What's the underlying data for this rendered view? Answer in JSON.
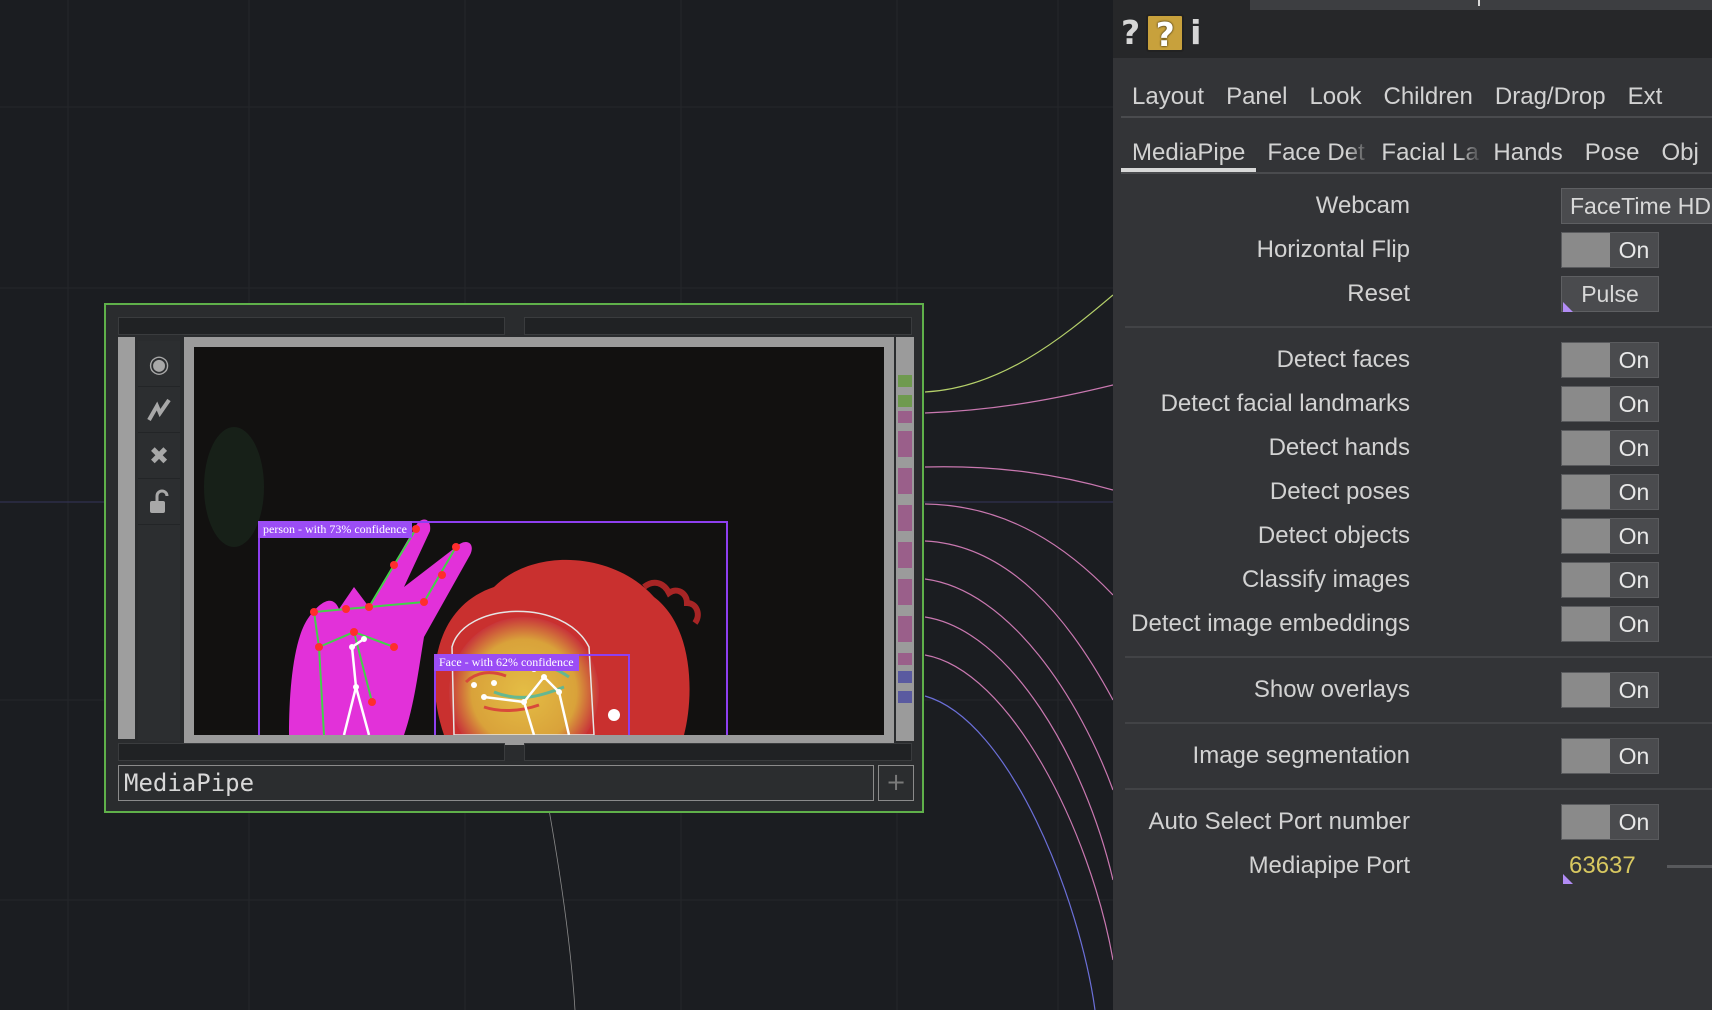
{
  "node": {
    "name": "MediaPipe",
    "tools": [
      "viewer-icon",
      "graph-icon",
      "bypass-icon",
      "lock-icon"
    ],
    "overlays": {
      "person_label": "person - with 73% confidence",
      "face_label": "Face - with 62% confidence"
    },
    "add_symbol": "+"
  },
  "panel": {
    "help_icons": [
      "?",
      "?",
      "i"
    ],
    "tabs_row1": [
      "Layout",
      "Panel",
      "Look",
      "Children",
      "Drag/Drop",
      "Ext"
    ],
    "tabs_row2": [
      "MediaPipe",
      "Face Det",
      "Facial La",
      "Hands",
      "Pose",
      "Obj"
    ],
    "active_tab": "MediaPipe",
    "params": {
      "webcam": {
        "label": "Webcam",
        "value": "FaceTime HD"
      },
      "hflip": {
        "label": "Horizontal Flip",
        "value": "On"
      },
      "reset": {
        "label": "Reset",
        "value": "Pulse"
      },
      "detect_faces": {
        "label": "Detect faces",
        "value": "On"
      },
      "detect_facial_landmarks": {
        "label": "Detect facial landmarks",
        "value": "On"
      },
      "detect_hands": {
        "label": "Detect hands",
        "value": "On"
      },
      "detect_poses": {
        "label": "Detect poses",
        "value": "On"
      },
      "detect_objects": {
        "label": "Detect objects",
        "value": "On"
      },
      "classify_images": {
        "label": "Classify images",
        "value": "On"
      },
      "detect_image_embeddings": {
        "label": "Detect image embeddings",
        "value": "On"
      },
      "show_overlays": {
        "label": "Show overlays",
        "value": "On"
      },
      "image_segmentation": {
        "label": "Image segmentation",
        "value": "On"
      },
      "auto_select_port": {
        "label": "Auto Select Port number",
        "value": "On"
      },
      "mediapipe_port": {
        "label": "Mediapipe Port",
        "value": "63637"
      }
    }
  },
  "colors": {
    "node_border": "#5fb04a",
    "bbox": "#8e3ff0",
    "port_value": "#d8c860",
    "wire_green": "#b5d06a",
    "wire_pink": "#c978b0",
    "wire_blue": "#6b6fd8"
  }
}
